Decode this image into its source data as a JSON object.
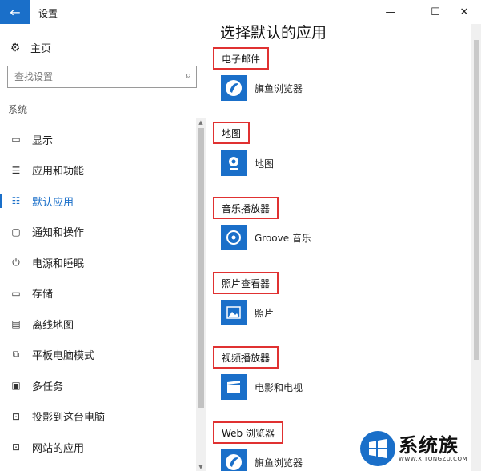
{
  "window": {
    "back_glyph": "←",
    "title": "设置",
    "minimize_glyph": "—",
    "maximize_glyph": "☐",
    "close_glyph": "✕"
  },
  "sidebar": {
    "home_icon": "gear-icon",
    "home_label": "主页",
    "search_placeholder": "查找设置",
    "section_label": "系统",
    "items": [
      {
        "label": "显示",
        "icon": "display-icon",
        "glyph": "▭"
      },
      {
        "label": "应用和功能",
        "icon": "list-icon",
        "glyph": "☰"
      },
      {
        "label": "默认应用",
        "icon": "default-apps-icon",
        "glyph": "☷",
        "active": true
      },
      {
        "label": "通知和操作",
        "icon": "notification-icon",
        "glyph": "▢"
      },
      {
        "label": "电源和睡眠",
        "icon": "power-icon",
        "glyph": "⏻"
      },
      {
        "label": "存储",
        "icon": "storage-icon",
        "glyph": "▭"
      },
      {
        "label": "离线地图",
        "icon": "map-icon",
        "glyph": "▤"
      },
      {
        "label": "平板电脑模式",
        "icon": "tablet-icon",
        "glyph": "⧉"
      },
      {
        "label": "多任务",
        "icon": "multitask-icon",
        "glyph": "▣"
      },
      {
        "label": "投影到这台电脑",
        "icon": "project-icon",
        "glyph": "⊡"
      },
      {
        "label": "网站的应用",
        "icon": "web-apps-icon",
        "glyph": "⊡"
      }
    ]
  },
  "main": {
    "heading": "选择默认的应用",
    "categories": [
      {
        "label": "电子邮件",
        "app": "旗鱼浏览器",
        "icon": "browser-icon"
      },
      {
        "label": "地图",
        "app": "地图",
        "icon": "maps-app-icon"
      },
      {
        "label": "音乐播放器",
        "app": "Groove 音乐",
        "icon": "groove-icon"
      },
      {
        "label": "照片查看器",
        "app": "照片",
        "icon": "photos-icon"
      },
      {
        "label": "视频播放器",
        "app": "电影和电视",
        "icon": "movies-icon"
      },
      {
        "label": "Web 浏览器",
        "app": "旗鱼浏览器",
        "icon": "browser-icon"
      }
    ]
  },
  "watermark": {
    "text": "系统族",
    "url": "WWW.XITONGZU.COM"
  },
  "colors": {
    "accent": "#1a6fc9",
    "highlight_box": "#e03131"
  }
}
